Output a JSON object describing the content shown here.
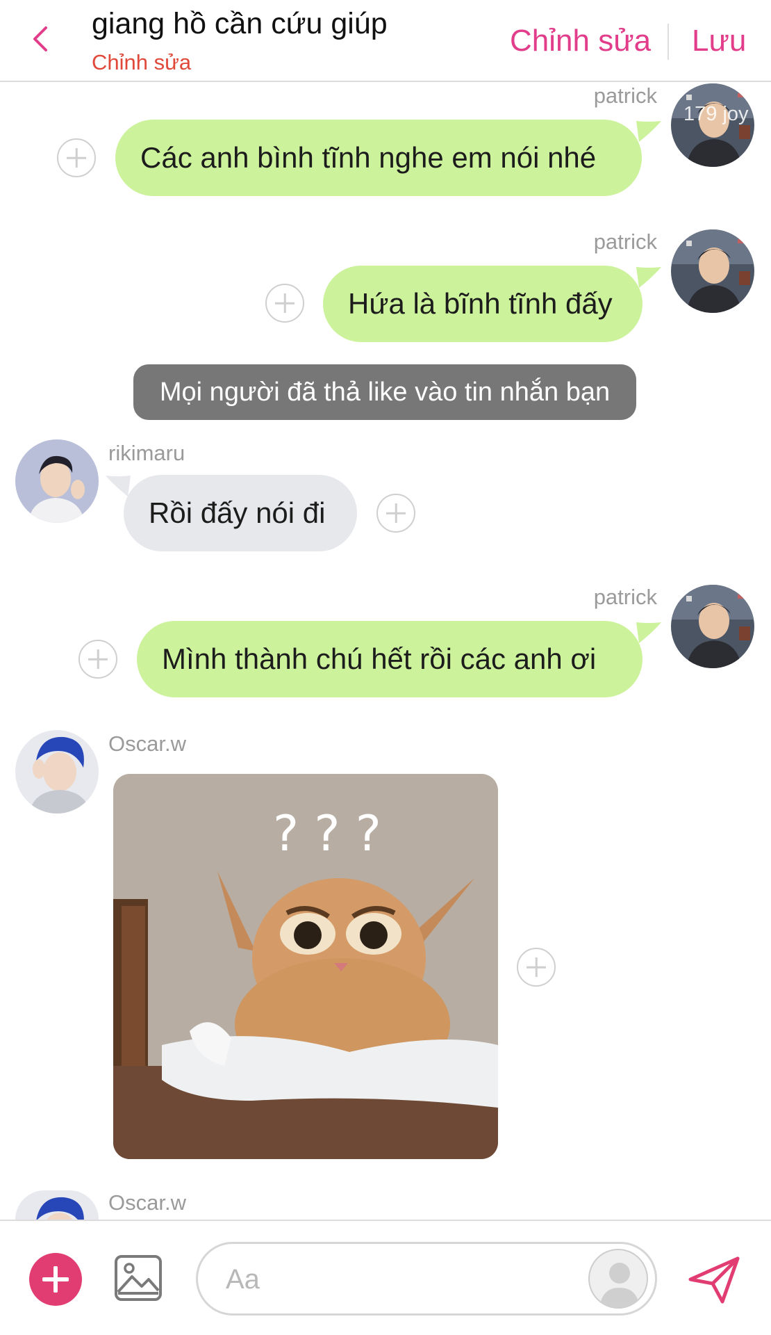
{
  "header": {
    "title": "giang hồ cần cứu giúp",
    "subtitle": "Chỉnh sửa",
    "edit_label": "Chỉnh sửa",
    "save_label": "Lưu"
  },
  "messages": [
    {
      "sender": "patrick",
      "text": "Các anh bình tĩnh nghe em nói nhé",
      "side": "right",
      "avatar_overlay": "179 joy"
    },
    {
      "sender": "patrick",
      "text": "Hứa là bĩnh tĩnh đấy",
      "side": "right"
    },
    {
      "system": "Mọi người đã thả like vào tin nhắn bạn"
    },
    {
      "sender": "rikimaru",
      "text": "Rồi đấy nói đi",
      "side": "left"
    },
    {
      "sender": "patrick",
      "text": "Mình thành chú hết rồi các anh ơi",
      "side": "right"
    },
    {
      "sender": "Oscar.w",
      "type": "image",
      "image_text": "? ? ?",
      "side": "left"
    },
    {
      "sender": "Oscar.w",
      "side": "left"
    }
  ],
  "composer": {
    "placeholder": "Aa"
  },
  "colors": {
    "accent": "#e23d8a",
    "green_bubble": "#cdf29c",
    "gray_bubble": "#e7e8ec",
    "system_pill": "#777777",
    "subtitle": "#e0493a",
    "add_button": "#e23d73"
  },
  "icons": [
    "back-chevron-icon",
    "plus-circle-icon",
    "image-gallery-icon",
    "user-placeholder-icon",
    "send-paper-plane-icon"
  ]
}
